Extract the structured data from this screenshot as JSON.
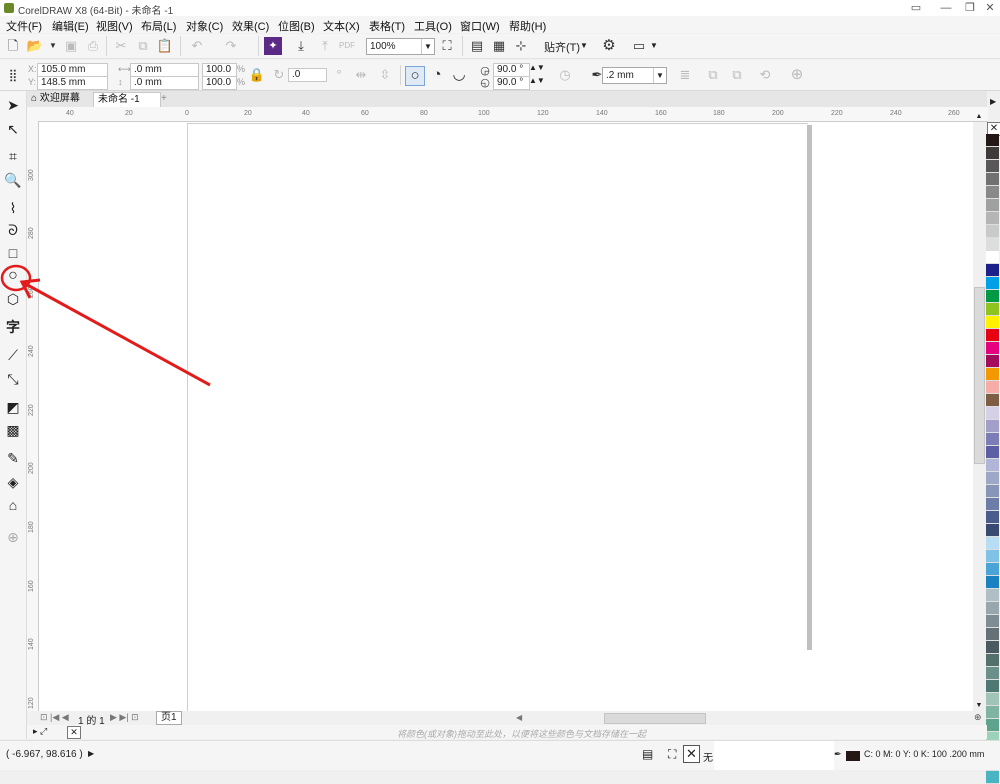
{
  "window": {
    "title": "CorelDRAW X8 (64-Bit) - 未命名 -1",
    "buttons": [
      "▭",
      "—",
      "❐"
    ]
  },
  "menu": [
    "文件(F)",
    "编辑(E)",
    "视图(V)",
    "布局(L)",
    "对象(C)",
    "效果(C)",
    "位图(B)",
    "文本(X)",
    "表格(T)",
    "工具(O)",
    "窗口(W)",
    "帮助(H)"
  ],
  "toolbar": {
    "zoom": "100%",
    "snap_label": "贴齐(T)"
  },
  "properties": {
    "x": "105.0 mm",
    "y": "148.5 mm",
    "width": ".0 mm",
    "height": ".0 mm",
    "scale_w": "100.0",
    "scale_h": "100.0",
    "percent": "%",
    "rotation": ".0",
    "start_angle": "90.0 °",
    "end_angle": "90.0 °",
    "outline_width": ".2 mm"
  },
  "tabs": {
    "welcome": "欢迎屏幕",
    "document": "未命名 -1",
    "add": "+"
  },
  "ruler_h": [
    "40",
    "20",
    "0",
    "20",
    "40",
    "60",
    "80",
    "100",
    "120",
    "140",
    "160",
    "180",
    "200",
    "220",
    "240",
    "260"
  ],
  "ruler_v": [
    "300",
    "280",
    "260",
    "240",
    "220",
    "200",
    "180",
    "160",
    "140",
    "120"
  ],
  "page_nav": {
    "count": "1 的 1",
    "page_tab": "页1"
  },
  "doc_palette_hint": "将颜色(或对象)拖动至此处，以便将这些颜色与文档存储在一起",
  "status": {
    "coords": "( -6.967, 98.616 )",
    "fill": "无",
    "outline": "C: 0 M: 0 Y: 0 K: 100 .200 mm"
  },
  "palette_colors": [
    "#231815",
    "#3e3a39",
    "#595757",
    "#727171",
    "#898989",
    "#9fa0a0",
    "#b5b5b6",
    "#c9caca",
    "#dcdddd",
    "#ffffff",
    "#1d2088",
    "#00a0e9",
    "#009944",
    "#8fc31f",
    "#fff100",
    "#e60012",
    "#e4007f",
    "#a40b5d",
    "#f39800",
    "#f6ada7",
    "#7d5e43",
    "#d6d0e6",
    "#a39fcb",
    "#7b7db6",
    "#5c5fa3",
    "#b1b6d8",
    "#9ca8c5",
    "#8796b8",
    "#6c7ea8",
    "#4a5c8c",
    "#384a73",
    "#b7ddf5",
    "#7fc2e6",
    "#4aa4d5",
    "#1b82c2",
    "#b0bec5",
    "#98a6ad",
    "#7e8c93",
    "#647278",
    "#4b5a60",
    "#54706d",
    "#6b8f8a",
    "#4d7873",
    "#a0c4b8",
    "#7fb3a2",
    "#5ea48c",
    "#9ad3b8",
    "#3da9ad",
    "#2b959c",
    "#4ab5c2"
  ]
}
